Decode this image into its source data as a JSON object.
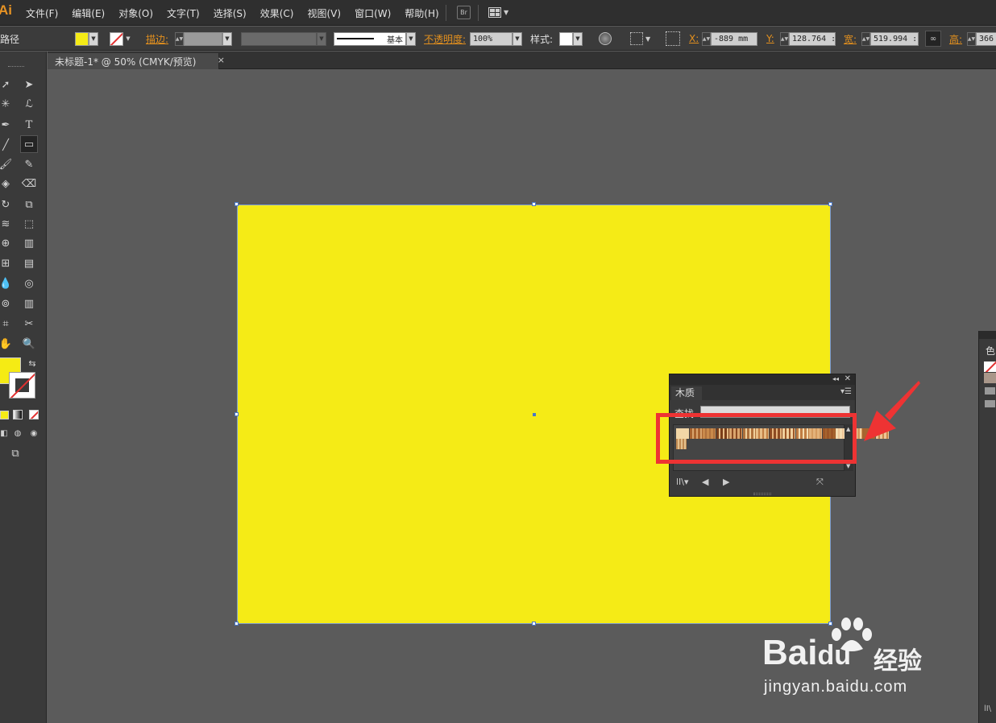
{
  "app": {
    "logo": "Ai"
  },
  "menu": [
    "文件(F)",
    "编辑(E)",
    "对象(O)",
    "文字(T)",
    "选择(S)",
    "效果(C)",
    "视图(V)",
    "窗口(W)",
    "帮助(H)"
  ],
  "topbar": {
    "bridge_label": "Br"
  },
  "control": {
    "object_type": "路径",
    "stroke_label": "描边:",
    "stroke_style": "基本",
    "opacity_label": "不透明度:",
    "opacity_value": "100%",
    "style_label": "样式:",
    "x_label": "X:",
    "x_value": "-889 mm",
    "y_label": "Y:",
    "y_value": "128.764 :",
    "w_label": "宽:",
    "w_value": "519.994 :",
    "h_label": "高:",
    "h_value": "366"
  },
  "document": {
    "tab_title": "未标题-1* @ 50% (CMYK/预览)",
    "close": "×"
  },
  "colors": {
    "fill": "#f5eb16",
    "accent_orange": "#e3901e",
    "selection_blue": "#4a78c6",
    "highlight_red": "#ee3333",
    "wood_swatches": [
      "#f2d6a6",
      "#a9642f",
      "#c98a4b",
      "#7b3e19",
      "#d9a56d",
      "#b0713c",
      "#e7bd86",
      "#8c4a22",
      "#f0cf9c",
      "#c07d43",
      "#e3b27a",
      "#9b5526",
      "#f4dcb0",
      "#d59a5e",
      "#a6652f",
      "#eec597"
    ]
  },
  "panel": {
    "tab": "木质",
    "find_label": "查找",
    "find_value": "",
    "menu_icon": "menu-icon"
  },
  "right_panel": {
    "tab": "色"
  },
  "watermark": {
    "brand": "Bai",
    "brand2": "du",
    "jingyan": "经验",
    "url": "jingyan.baidu.com"
  }
}
